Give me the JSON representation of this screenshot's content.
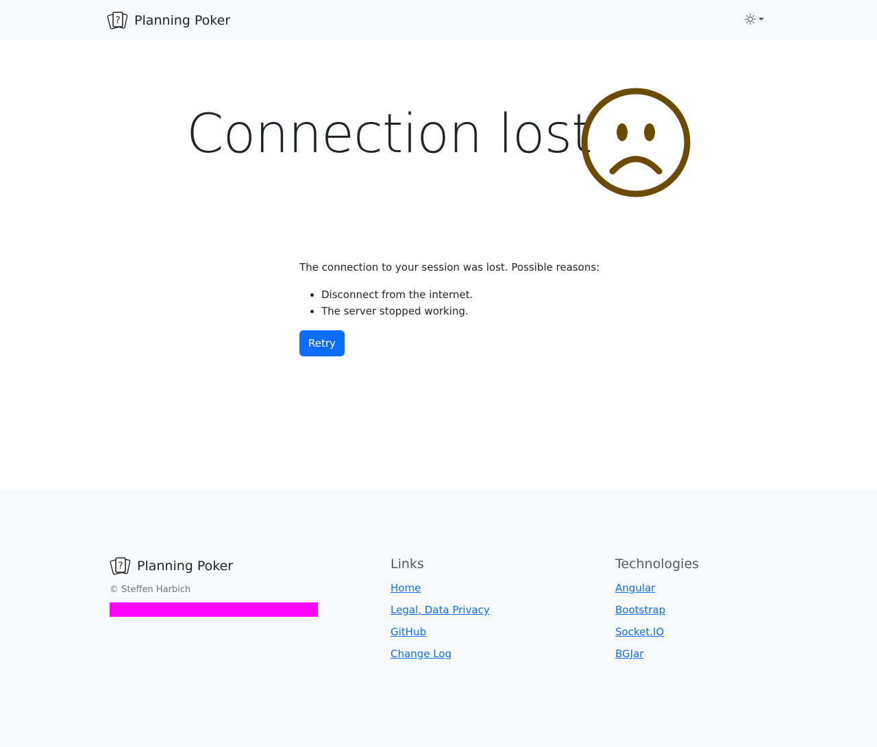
{
  "navbar": {
    "brand_name": "Planning Poker",
    "logo_icon": "cards-icon",
    "theme_icon": "sun-icon"
  },
  "hero": {
    "title": "Connection lost",
    "face_icon": "sad-face-icon",
    "face_color": "#6b4b00"
  },
  "message": {
    "intro": "The connection to your session was lost. Possible reasons:",
    "reasons": [
      "Disconnect from the internet.",
      "The server stopped working."
    ],
    "retry_label": "Retry"
  },
  "footer": {
    "brand_name": "Planning Poker",
    "copyright": "© Steffen Harbich",
    "links": {
      "heading": "Links",
      "items": [
        "Home",
        "Legal, Data Privacy",
        "GitHub",
        "Change Log"
      ]
    },
    "technologies": {
      "heading": "Technologies",
      "items": [
        "Angular",
        "Bootstrap",
        "Socket.IO",
        "BGJar"
      ]
    }
  },
  "colors": {
    "primary": "#0d6efd",
    "navbar_bg": "#f8f9fa",
    "redaction": "#ff00ff"
  }
}
